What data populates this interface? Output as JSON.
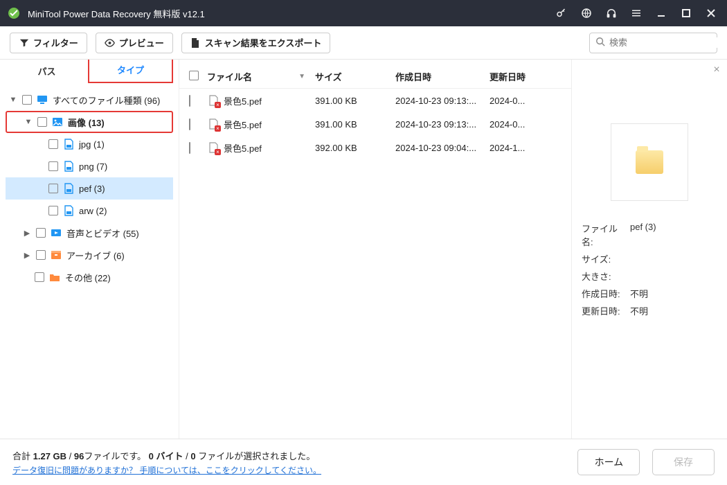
{
  "titlebar": {
    "title": "MiniTool Power Data Recovery 無料版 v12.1"
  },
  "toolbar": {
    "filter": "フィルター",
    "preview": "プレビュー",
    "export": "スキャン結果をエクスポート",
    "search_placeholder": "検索"
  },
  "tabs": {
    "path": "パス",
    "type": "タイプ"
  },
  "tree": {
    "root": "すべてのファイル種類 (96)",
    "images": "画像 (13)",
    "jpg": "jpg (1)",
    "png": "png (7)",
    "pef": "pef (3)",
    "arw": "arw (2)",
    "av": "音声とビデオ (55)",
    "archive": "アーカイブ (6)",
    "other": "その他 (22)"
  },
  "table": {
    "h_name": "ファイル名",
    "h_size": "サイズ",
    "h_created": "作成日時",
    "h_mod": "更新日時",
    "rows": [
      {
        "name": "景色5.pef",
        "size": "391.00 KB",
        "created": "2024-10-23 09:13:...",
        "mod": "2024-0..."
      },
      {
        "name": "景色5.pef",
        "size": "391.00 KB",
        "created": "2024-10-23 09:13:...",
        "mod": "2024-0..."
      },
      {
        "name": "景色5.pef",
        "size": "392.00 KB",
        "created": "2024-10-23 09:04:...",
        "mod": "2024-1..."
      }
    ]
  },
  "preview": {
    "k_name": "ファイル名:",
    "v_name": "pef (3)",
    "k_size": "サイズ:",
    "v_size": "",
    "k_dim": "大きさ:",
    "v_dim": "",
    "k_created": "作成日時:",
    "v_created": "不明",
    "k_mod": "更新日時:",
    "v_mod": "不明"
  },
  "status": {
    "total_prefix": "合計 ",
    "total_size": "1.27 GB",
    "slash": " / ",
    "total_files": "96",
    "total_suffix": "ファイルです。 ",
    "sel_bytes": "0 バイト",
    "sel_mid": " / ",
    "sel_files": "0",
    "sel_suffix": " ファイルが選択されました。",
    "help": "データ復旧に問題がありますか？ 手順については、ここをクリックしてください。",
    "home": "ホーム",
    "save": "保存"
  }
}
